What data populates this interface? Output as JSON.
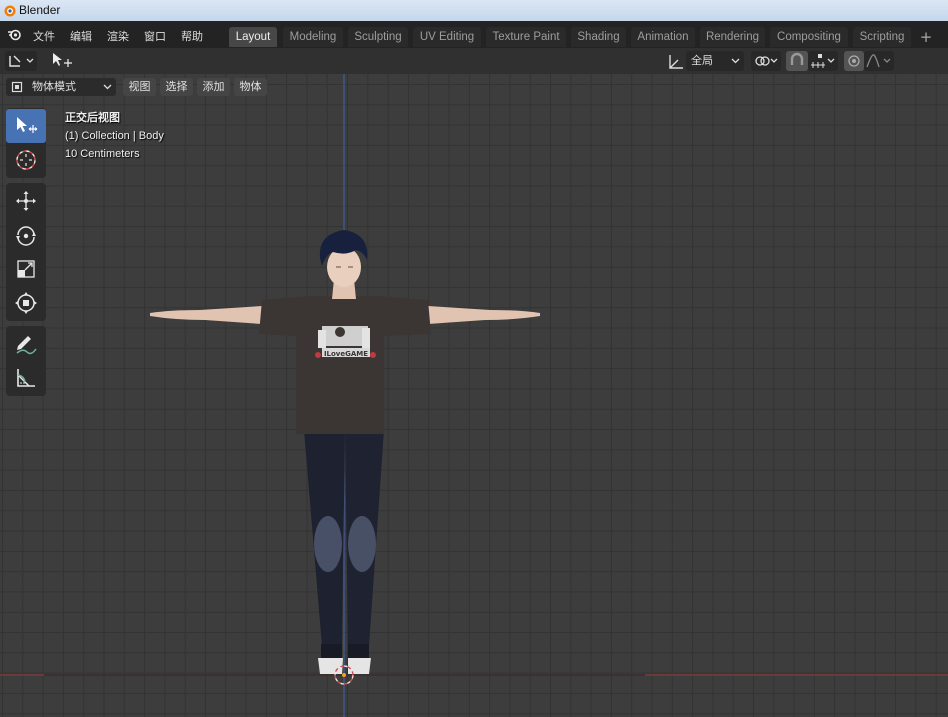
{
  "window": {
    "title": "Blender"
  },
  "menu": [
    "文件",
    "编辑",
    "渲染",
    "窗口",
    "帮助"
  ],
  "workspaces": [
    "Layout",
    "Modeling",
    "Sculpting",
    "UV Editing",
    "Texture Paint",
    "Shading",
    "Animation",
    "Rendering",
    "Compositing",
    "Scripting"
  ],
  "active_workspace": "Layout",
  "header": {
    "transform_orientation": "全局"
  },
  "viewport_header": {
    "mode": "物体模式",
    "menus": [
      "视图",
      "选择",
      "添加",
      "物体"
    ]
  },
  "viewport_info": {
    "view_name": "正交后视图",
    "collection": "(1) Collection | Body",
    "scale": "10 Centimeters"
  },
  "model": {
    "shirt_text": "ILoveGAME"
  },
  "colors": {
    "accent": "#4772b3",
    "x_axis": "#8a3a3a",
    "z_axis": "#3f5e9e",
    "background": "#3d3d3d"
  },
  "toolbar_icons": [
    "select-box-icon",
    "cursor-icon",
    "move-icon",
    "rotate-icon",
    "scale-icon",
    "transform-icon",
    "annotate-icon",
    "measure-icon"
  ]
}
